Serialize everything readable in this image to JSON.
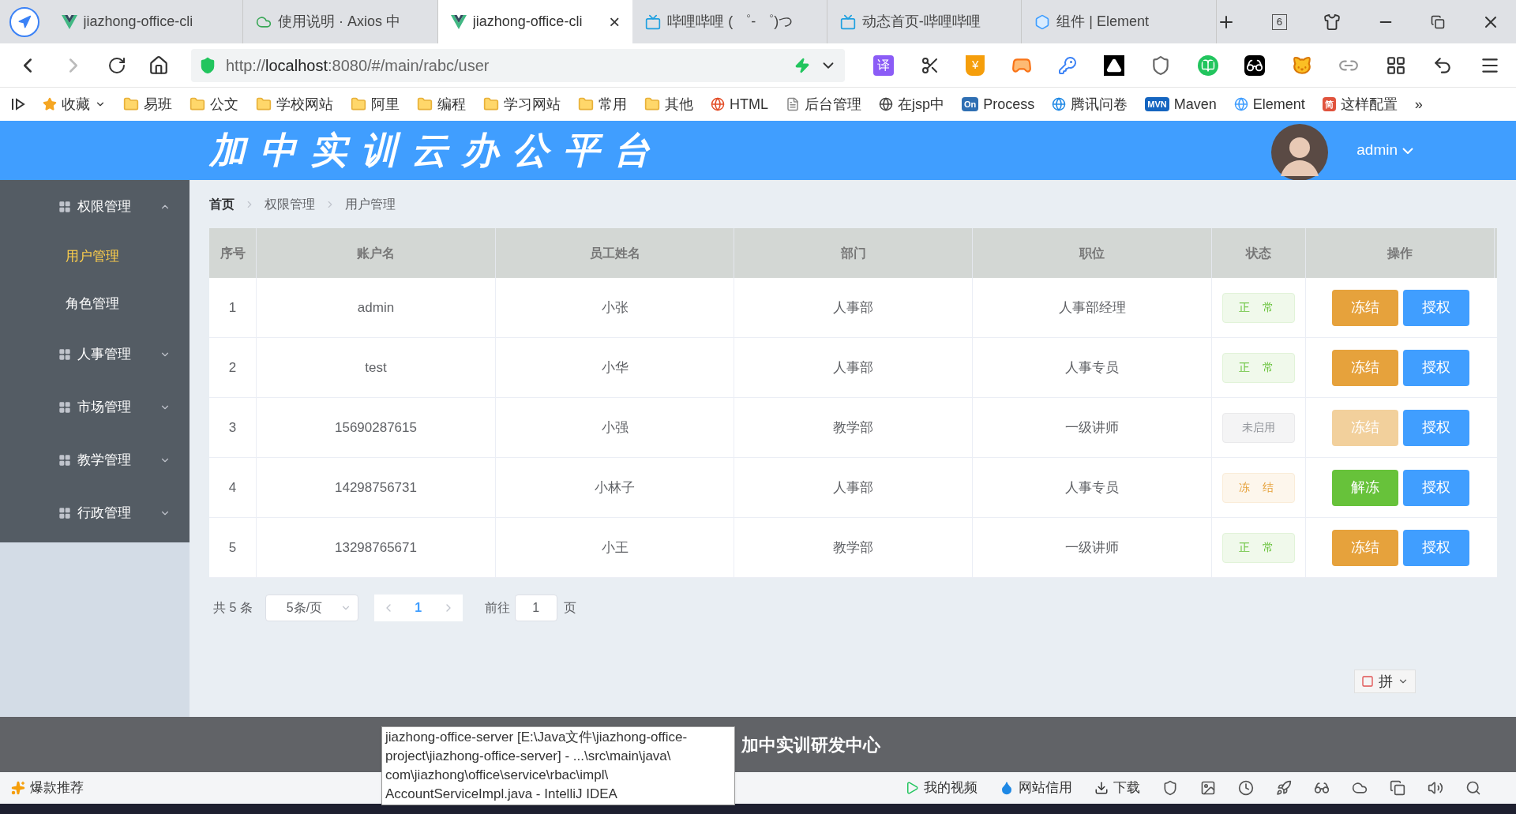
{
  "browser": {
    "tabs": [
      {
        "title": "jiazhong-office-cli",
        "kind": "vue",
        "selected": false
      },
      {
        "title": "使用说明 · Axios 中",
        "kind": "cloud",
        "selected": false
      },
      {
        "title": "jiazhong-office-cli",
        "kind": "vue",
        "selected": true,
        "close": "×"
      },
      {
        "title": "哔哩哔哩 ( ゜- ゜)つ",
        "kind": "tv",
        "selected": false
      },
      {
        "title": "动态首页-哔哩哔哩",
        "kind": "tv",
        "selected": false
      },
      {
        "title": "组件 | Element",
        "kind": "element",
        "selected": false
      }
    ],
    "tab_count": "6",
    "url": {
      "scheme": "http://",
      "host": "localhost",
      "path": ":8080/#/main/rabc/user"
    },
    "translate_glyph": "译",
    "wallet_glyph": "¥",
    "bookmarks": [
      {
        "kind": "star",
        "label": "收藏"
      },
      {
        "kind": "folder",
        "label": "易班"
      },
      {
        "kind": "folder",
        "label": "公文"
      },
      {
        "kind": "folder",
        "label": "学校网站"
      },
      {
        "kind": "folder",
        "label": "阿里"
      },
      {
        "kind": "folder",
        "label": "编程"
      },
      {
        "kind": "folder",
        "label": "学习网站"
      },
      {
        "kind": "folder",
        "label": "常用"
      },
      {
        "kind": "folder",
        "label": "其他"
      },
      {
        "kind": "link",
        "label": "HTML",
        "color": "#e34c26"
      },
      {
        "kind": "page",
        "label": "后台管理"
      },
      {
        "kind": "link",
        "label": "在jsp中",
        "color": "#444444"
      },
      {
        "kind": "badge",
        "badge": "On",
        "label": "Process",
        "color": "#2f6fb3"
      },
      {
        "kind": "link",
        "label": "腾讯问卷",
        "color": "#1e88e5"
      },
      {
        "kind": "badge",
        "badge": "MVN",
        "label": "Maven",
        "color": "#1565c0"
      },
      {
        "kind": "link",
        "label": "Element",
        "color": "#409eff"
      },
      {
        "kind": "badge",
        "badge": "简",
        "label": "这样配置",
        "color": "#e0533d"
      }
    ],
    "more": "»"
  },
  "app": {
    "title": "加中实训云办公平台",
    "user": "admin",
    "menu": [
      {
        "label": "权限管理",
        "expanded": true,
        "children": [
          {
            "label": "用户管理",
            "selected": true
          },
          {
            "label": "角色管理",
            "selected": false
          }
        ]
      },
      {
        "label": "人事管理",
        "expanded": false
      },
      {
        "label": "市场管理",
        "expanded": false
      },
      {
        "label": "教学管理",
        "expanded": false
      },
      {
        "label": "行政管理",
        "expanded": false
      }
    ],
    "breadcrumb": [
      "首页",
      "权限管理",
      "用户管理"
    ],
    "table": {
      "columns": [
        "序号",
        "账户名",
        "员工姓名",
        "部门",
        "职位",
        "状态",
        "操作"
      ],
      "rows": [
        {
          "index": "1",
          "account": "admin",
          "name": "小张",
          "dept": "人事部",
          "position": "人事部经理",
          "status": {
            "kind": "normal",
            "label": "正 常"
          },
          "action": {
            "kind": "freeze",
            "label": "冻结",
            "disabled": false
          },
          "grant": "授权"
        },
        {
          "index": "2",
          "account": "test",
          "name": "小华",
          "dept": "人事部",
          "position": "人事专员",
          "status": {
            "kind": "normal",
            "label": "正 常"
          },
          "action": {
            "kind": "freeze",
            "label": "冻结",
            "disabled": false
          },
          "grant": "授权"
        },
        {
          "index": "3",
          "account": "15690287615",
          "name": "小强",
          "dept": "教学部",
          "position": "一级讲师",
          "status": {
            "kind": "inactive",
            "label": "未启用"
          },
          "action": {
            "kind": "freeze",
            "label": "冻结",
            "disabled": true
          },
          "grant": "授权"
        },
        {
          "index": "4",
          "account": "14298756731",
          "name": "小林子",
          "dept": "人事部",
          "position": "人事专员",
          "status": {
            "kind": "frozen",
            "label": "冻 结"
          },
          "action": {
            "kind": "unfreeze",
            "label": "解冻",
            "disabled": false
          },
          "grant": "授权"
        },
        {
          "index": "5",
          "account": "13298765671",
          "name": "小王",
          "dept": "教学部",
          "position": "一级讲师",
          "status": {
            "kind": "normal",
            "label": "正 常"
          },
          "action": {
            "kind": "freeze",
            "label": "冻结",
            "disabled": false
          },
          "grant": "授权"
        }
      ]
    },
    "pagination": {
      "total": "共 5 条",
      "page_size": "5条/页",
      "pages": [
        {
          "label": "1",
          "selected": true
        }
      ],
      "goto": "前往",
      "goto_value": "1",
      "unit": "页"
    },
    "ime": {
      "label": "拼"
    },
    "footer": "加中实训研发中心"
  },
  "tooltip": [
    "jiazhong-office-server [E:\\Java文件\\jiazhong-office-",
    "project\\jiazhong-office-server] - ...\\src\\main\\java\\",
    "com\\jiazhong\\office\\service\\rbac\\impl\\",
    "AccountServiceImpl.java - IntelliJ IDEA"
  ],
  "status_bar": {
    "left": "爆款推荐",
    "items": [
      {
        "kind": "video",
        "label": "我的视频"
      },
      {
        "kind": "credit",
        "label": "网站信用"
      },
      {
        "kind": "download",
        "label": "下载"
      }
    ]
  }
}
